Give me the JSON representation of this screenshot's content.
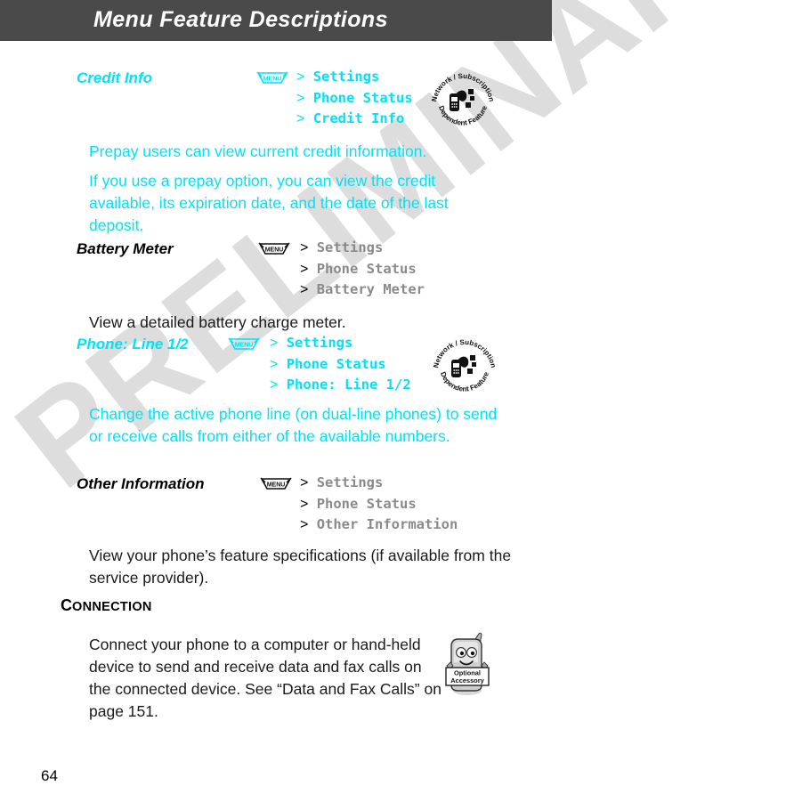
{
  "header": {
    "title": "Menu Feature Descriptions",
    "background": "#4a4a4a",
    "text_color": "#ffffff"
  },
  "watermark": {
    "text": "PRELIMINARY",
    "color": "#dddddd"
  },
  "colors": {
    "cyan": "#00e2f5",
    "gray_menu_item": "#8a8a8a",
    "black": "#000000"
  },
  "icons": {
    "menu_key_label": "MENU",
    "network_badge_top": "Network / Subscription",
    "network_badge_bottom": "Dependent Feature",
    "accessory_badge_line1": "Optional",
    "accessory_badge_line2": "Accessory"
  },
  "features": [
    {
      "label": "Credit Info",
      "label_color": "cyan",
      "menu_color": "cyan",
      "menu_key": "MENU",
      "path": [
        "Settings",
        "Phone Status",
        "Credit Info"
      ],
      "badge": "network-subscription",
      "paragraphs": [
        "Prepay users can view current credit information.",
        "If you use a prepay option, you can view the credit available, its expiration date, and the date of the last deposit."
      ]
    },
    {
      "label": "Battery Meter",
      "label_color": "black",
      "menu_color": "black",
      "menu_key": "MENU",
      "path": [
        "Settings",
        "Phone Status",
        "Battery Meter"
      ],
      "badge": "none",
      "paragraphs": [
        "View a detailed battery charge meter."
      ]
    },
    {
      "label": "Phone: Line 1/2",
      "label_color": "cyan",
      "menu_color": "cyan",
      "menu_key": "MENU",
      "path": [
        "Settings",
        "Phone Status",
        "Phone: Line 1/2"
      ],
      "badge": "network-subscription",
      "paragraphs": [
        "Change the active phone line (on dual-line phones) to send or receive calls from either of the available numbers."
      ]
    },
    {
      "label": "Other Information",
      "label_color": "black",
      "menu_color": "black",
      "menu_key": "MENU",
      "path": [
        "Settings",
        "Phone Status",
        "Other Information"
      ],
      "badge": "none",
      "paragraphs": [
        "View your phone’s feature specifications (if available from the service provider)."
      ]
    }
  ],
  "section": {
    "heading_cap": "C",
    "heading_rest": "ONNECTION",
    "paragraph": "Connect your phone to a computer or hand-held device to send and receive data and fax calls on the connected device. See “Data and Fax Calls” on page 151.",
    "badge": "optional-accessory"
  },
  "footer": {
    "page_number": "64"
  }
}
